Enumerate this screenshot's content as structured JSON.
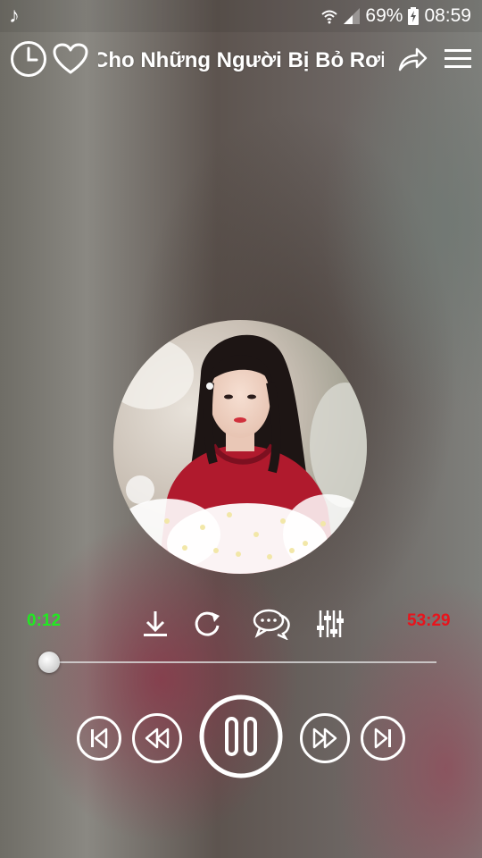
{
  "status": {
    "notification_icon": "music-note-icon",
    "battery": "69%",
    "time": "08:59"
  },
  "player": {
    "song_title": "Cho Những Người Bị Bỏ Rơi",
    "elapsed": "0:12",
    "total": "53:29",
    "progress": 0.004
  },
  "colors": {
    "elapsed": "#22e822",
    "total": "#e8141c"
  }
}
